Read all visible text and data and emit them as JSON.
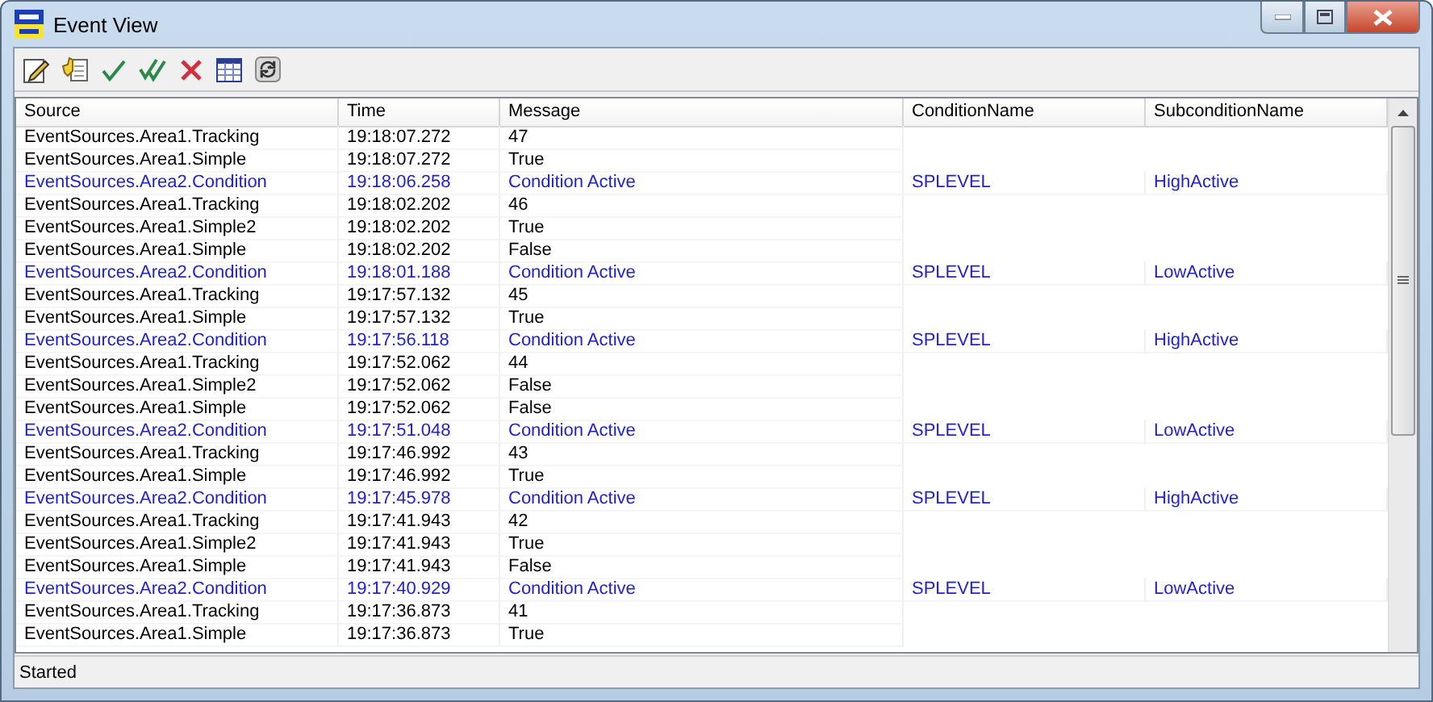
{
  "window": {
    "title": "Event View"
  },
  "table": {
    "columns": [
      "Source",
      "Time",
      "Message",
      "ConditionName",
      "SubconditionName"
    ],
    "rows": [
      {
        "cells": [
          "EventSources.Area1.Tracking",
          "19:18:07.272",
          "47",
          "",
          ""
        ],
        "color": "#000000"
      },
      {
        "cells": [
          "EventSources.Area1.Simple",
          "19:18:07.272",
          "True",
          "",
          ""
        ],
        "color": "#000000"
      },
      {
        "cells": [
          "EventSources.Area2.Condition",
          "19:18:06.258",
          "Condition Active",
          "SPLEVEL",
          "HighActive"
        ],
        "color": "#2222cc"
      },
      {
        "cells": [
          "EventSources.Area1.Tracking",
          "19:18:02.202",
          "46",
          "",
          ""
        ],
        "color": "#000000"
      },
      {
        "cells": [
          "EventSources.Area1.Simple2",
          "19:18:02.202",
          "True",
          "",
          ""
        ],
        "color": "#000000"
      },
      {
        "cells": [
          "EventSources.Area1.Simple",
          "19:18:02.202",
          "False",
          "",
          ""
        ],
        "color": "#000000"
      },
      {
        "cells": [
          "EventSources.Area2.Condition",
          "19:18:01.188",
          "Condition Active",
          "SPLEVEL",
          "LowActive"
        ],
        "color": "#2222cc"
      },
      {
        "cells": [
          "EventSources.Area1.Tracking",
          "19:17:57.132",
          "45",
          "",
          ""
        ],
        "color": "#000000"
      },
      {
        "cells": [
          "EventSources.Area1.Simple",
          "19:17:57.132",
          "True",
          "",
          ""
        ],
        "color": "#000000"
      },
      {
        "cells": [
          "EventSources.Area2.Condition",
          "19:17:56.118",
          "Condition Active",
          "SPLEVEL",
          "HighActive"
        ],
        "color": "#2222cc"
      },
      {
        "cells": [
          "EventSources.Area1.Tracking",
          "19:17:52.062",
          "44",
          "",
          ""
        ],
        "color": "#000000"
      },
      {
        "cells": [
          "EventSources.Area1.Simple2",
          "19:17:52.062",
          "False",
          "",
          ""
        ],
        "color": "#000000"
      },
      {
        "cells": [
          "EventSources.Area1.Simple",
          "19:17:52.062",
          "False",
          "",
          ""
        ],
        "color": "#000000"
      },
      {
        "cells": [
          "EventSources.Area2.Condition",
          "19:17:51.048",
          "Condition Active",
          "SPLEVEL",
          "LowActive"
        ],
        "color": "#2222cc"
      },
      {
        "cells": [
          "EventSources.Area1.Tracking",
          "19:17:46.992",
          "43",
          "",
          ""
        ],
        "color": "#000000"
      },
      {
        "cells": [
          "EventSources.Area1.Simple",
          "19:17:46.992",
          "True",
          "",
          ""
        ],
        "color": "#000000"
      },
      {
        "cells": [
          "EventSources.Area2.Condition",
          "19:17:45.978",
          "Condition Active",
          "SPLEVEL",
          "HighActive"
        ],
        "color": "#2222cc"
      },
      {
        "cells": [
          "EventSources.Area1.Tracking",
          "19:17:41.943",
          "42",
          "",
          ""
        ],
        "color": "#000000"
      },
      {
        "cells": [
          "EventSources.Area1.Simple2",
          "19:17:41.943",
          "True",
          "",
          ""
        ],
        "color": "#000000"
      },
      {
        "cells": [
          "EventSources.Area1.Simple",
          "19:17:41.943",
          "False",
          "",
          ""
        ],
        "color": "#000000"
      },
      {
        "cells": [
          "EventSources.Area2.Condition",
          "19:17:40.929",
          "Condition Active",
          "SPLEVEL",
          "LowActive"
        ],
        "color": "#2222cc"
      },
      {
        "cells": [
          "EventSources.Area1.Tracking",
          "19:17:36.873",
          "41",
          "",
          ""
        ],
        "color": "#000000"
      },
      {
        "cells": [
          "EventSources.Area1.Simple",
          "19:17:36.873",
          "True",
          "",
          ""
        ],
        "color": "#000000"
      }
    ]
  },
  "status_bar": "Started"
}
